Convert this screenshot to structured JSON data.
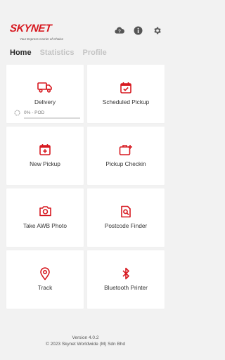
{
  "brand": {
    "name": "SKYNET",
    "tagline": "Your Express Carrier of Choice",
    "accent_color": "#d71920"
  },
  "header": {
    "icons": [
      "cloud-question-icon",
      "info-icon",
      "gear-icon"
    ]
  },
  "tabs": [
    {
      "label": "Home",
      "active": true
    },
    {
      "label": "Statistics",
      "active": false
    },
    {
      "label": "Profile",
      "active": false
    }
  ],
  "tiles": [
    {
      "label": "Delivery",
      "icon": "truck-icon"
    },
    {
      "label": "Scheduled Pickup",
      "icon": "calendar-check-icon"
    },
    {
      "label": "New Pickup",
      "icon": "calendar-plus-icon"
    },
    {
      "label": "Pickup Checkin",
      "icon": "briefcase-plus-icon"
    },
    {
      "label": "Take AWB Photo",
      "icon": "camera-icon"
    },
    {
      "label": "Postcode Finder",
      "icon": "document-search-icon"
    },
    {
      "label": "Track",
      "icon": "location-pin-icon"
    },
    {
      "label": "Bluetooth Printer",
      "icon": "bluetooth-icon"
    }
  ],
  "delivery_progress": {
    "text": "0% - POD",
    "percent": 0
  },
  "footer": {
    "version": "Version 4.0.2",
    "copyright": "© 2023 Skynet Worldwide (M) Sdn Bhd"
  }
}
